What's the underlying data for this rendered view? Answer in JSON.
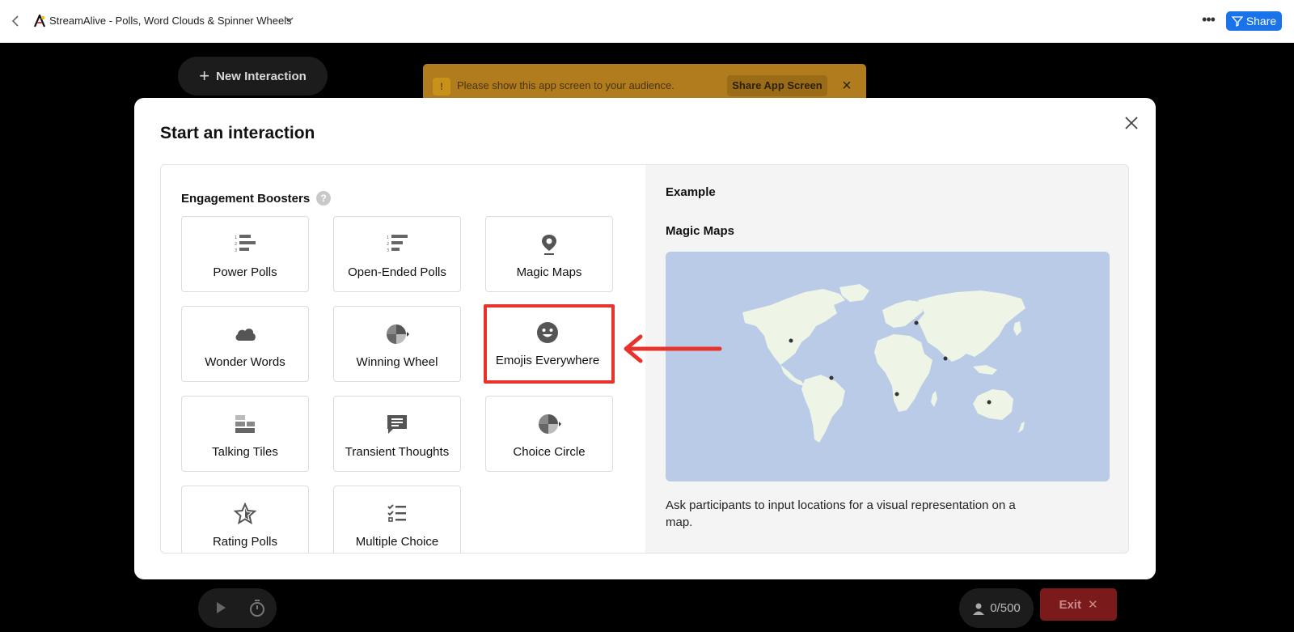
{
  "topbar": {
    "title": "StreamAlive - Polls, Word Clouds & Spinner Wheels",
    "share_label": "Share",
    "icons": [
      "back-chevron-icon",
      "streamalive-logo",
      "chevron-down-icon",
      "more-dots-icon",
      "share-icon"
    ]
  },
  "background": {
    "new_interaction_label": "New Interaction",
    "notice_text": "Please show this app screen to your audience.",
    "notice_button": "Share App Screen",
    "participants": "0/500",
    "exit_label": "Exit"
  },
  "modal": {
    "title": "Start an interaction",
    "section_title": "Engagement Boosters",
    "cards": [
      {
        "label": "Power Polls",
        "icon": "ranked-list-icon"
      },
      {
        "label": "Open-Ended Polls",
        "icon": "ranked-list-icon"
      },
      {
        "label": "Magic Maps",
        "icon": "map-pin-icon"
      },
      {
        "label": "Wonder Words",
        "icon": "cloud-icon"
      },
      {
        "label": "Winning Wheel",
        "icon": "spinner-wheel-icon"
      },
      {
        "label": "Emojis Everywhere",
        "icon": "smiley-icon",
        "highlighted": true
      },
      {
        "label": "Talking Tiles",
        "icon": "tiles-icon"
      },
      {
        "label": "Transient Thoughts",
        "icon": "speech-bubble-icon"
      },
      {
        "label": "Choice Circle",
        "icon": "spinner-wheel-icon"
      },
      {
        "label": "Rating Polls",
        "icon": "star-icon"
      },
      {
        "label": "Multiple Choice",
        "icon": "checklist-icon"
      }
    ],
    "example": {
      "label": "Example",
      "name": "Magic Maps",
      "description": "Ask participants to input locations for a visual representation on a map."
    }
  },
  "colors": {
    "share_blue": "#1a73e8",
    "highlight_red": "#e8332d",
    "map_water": "#b9cbe6",
    "map_land": "#eef5e6",
    "notice_amber": "#b07c1e",
    "exit_red": "#7a1a1a"
  }
}
